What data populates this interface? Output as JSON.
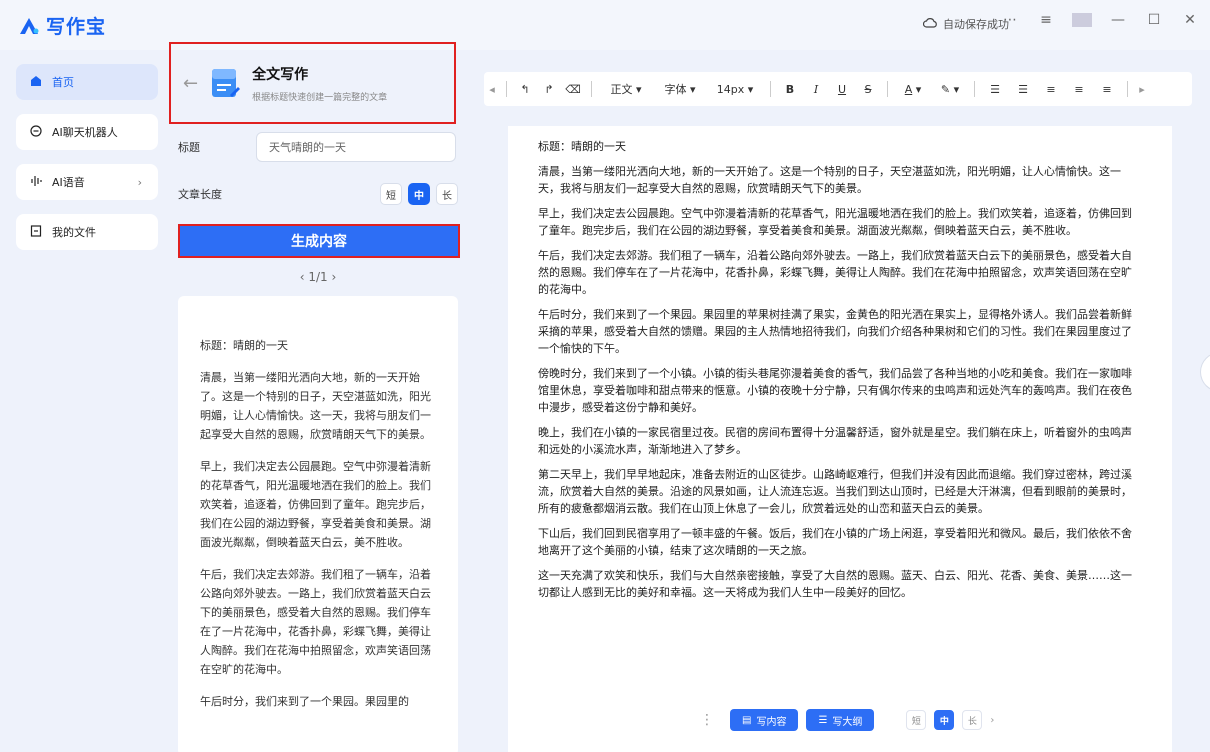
{
  "app": {
    "name": "写作宝",
    "brand_color": "#1a64f2"
  },
  "topbar": {
    "autosave": "自动保存成功"
  },
  "nav": {
    "items": [
      {
        "label": "首页",
        "icon": "home-icon",
        "active": true
      },
      {
        "label": "AI聊天机器人",
        "icon": "chat-icon"
      },
      {
        "label": "AI语音",
        "icon": "voice-icon"
      },
      {
        "label": "我的文件",
        "icon": "file-icon"
      }
    ]
  },
  "panel": {
    "title": "全文写作",
    "subtitle": "根据标题快速创建一篇完整的文章",
    "title_label": "标题",
    "title_value": "天气晴朗的一天",
    "length_label": "文章长度",
    "length_options": [
      "短",
      "中",
      "长"
    ],
    "length_selected": "中",
    "generate_label": "生成内容",
    "pager": "1/1"
  },
  "output": {
    "paragraphs": [
      "标题：晴朗的一天",
      "清晨，当第一缕阳光洒向大地，新的一天开始了。这是一个特别的日子，天空湛蓝如洗，阳光明媚，让人心情愉快。这一天，我将与朋友们一起享受大自然的恩赐，欣赏晴朗天气下的美景。",
      "早上，我们决定去公园晨跑。空气中弥漫着清新的花草香气，阳光温暖地洒在我们的脸上。我们欢笑着，追逐着，仿佛回到了童年。跑完步后，我们在公园的湖边野餐，享受着美食和美景。湖面波光粼粼，倒映着蓝天白云，美不胜收。",
      "午后，我们决定去郊游。我们租了一辆车，沿着公路向郊外驶去。一路上，我们欣赏着蓝天白云下的美丽景色，感受着大自然的恩赐。我们停车在了一片花海中，花香扑鼻，彩蝶飞舞，美得让人陶醉。我们在花海中拍照留念，欢声笑语回荡在空旷的花海中。",
      "午后时分，我们来到了一个果园。果园里的"
    ]
  },
  "toolbar": {
    "style": "正文",
    "font": "字体",
    "size": "14px",
    "bold": "B",
    "italic": "I",
    "underline": "U",
    "strike": "S",
    "font_color": "A"
  },
  "document": {
    "paragraphs": [
      "标题：晴朗的一天",
      "清晨，当第一缕阳光洒向大地，新的一天开始了。这是一个特别的日子，天空湛蓝如洗，阳光明媚，让人心情愉快。这一天，我将与朋友们一起享受大自然的恩赐，欣赏晴朗天气下的美景。",
      "早上，我们决定去公园晨跑。空气中弥漫着清新的花草香气，阳光温暖地洒在我们的脸上。我们欢笑着，追逐着，仿佛回到了童年。跑完步后，我们在公园的湖边野餐，享受着美食和美景。湖面波光粼粼，倒映着蓝天白云，美不胜收。",
      "午后，我们决定去郊游。我们租了一辆车，沿着公路向郊外驶去。一路上，我们欣赏着蓝天白云下的美丽景色，感受着大自然的恩赐。我们停车在了一片花海中，花香扑鼻，彩蝶飞舞，美得让人陶醉。我们在花海中拍照留念，欢声笑语回荡在空旷的花海中。",
      "午后时分，我们来到了一个果园。果园里的苹果树挂满了果实，金黄色的阳光洒在果实上，显得格外诱人。我们品尝着新鲜采摘的苹果，感受着大自然的馈赠。果园的主人热情地招待我们，向我们介绍各种果树和它们的习性。我们在果园里度过了一个愉快的下午。",
      "傍晚时分，我们来到了一个小镇。小镇的街头巷尾弥漫着美食的香气，我们品尝了各种当地的小吃和美食。我们在一家咖啡馆里休息，享受着咖啡和甜点带来的惬意。小镇的夜晚十分宁静，只有偶尔传来的虫鸣声和远处汽车的轰鸣声。我们在夜色中漫步，感受着这份宁静和美好。",
      "晚上，我们在小镇的一家民宿里过夜。民宿的房间布置得十分温馨舒适，窗外就是星空。我们躺在床上，听着窗外的虫鸣声和远处的小溪流水声，渐渐地进入了梦乡。",
      "第二天早上，我们早早地起床，准备去附近的山区徒步。山路崎岖难行，但我们并没有因此而退缩。我们穿过密林，跨过溪流，欣赏着大自然的美景。沿途的风景如画，让人流连忘返。当我们到达山顶时，已经是大汗淋漓，但看到眼前的美景时，所有的疲惫都烟消云散。我们在山顶上休息了一会儿，欣赏着远处的山峦和蓝天白云的美景。",
      "下山后，我们回到民宿享用了一顿丰盛的午餐。饭后，我们在小镇的广场上闲逛，享受着阳光和微风。最后，我们依依不舍地离开了这个美丽的小镇，结束了这次晴朗的一天之旅。",
      "这一天充满了欢笑和快乐，我们与大自然亲密接触，享受了大自然的恩赐。蓝天、白云、阳光、花香、美食、美景……这一切都让人感到无比的美好和幸福。这一天将成为我们人生中一段美好的回忆。"
    ]
  },
  "doc_bar": {
    "write_content": "写内容",
    "write_outline": "写大纲",
    "length_options": [
      "短",
      "中",
      "长"
    ]
  }
}
